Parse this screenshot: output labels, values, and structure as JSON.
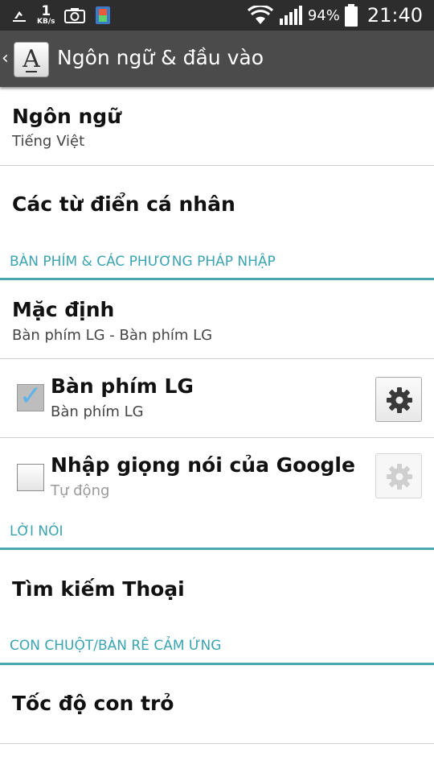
{
  "status_bar": {
    "data_rate_value": "1",
    "data_rate_unit": "KB/s",
    "battery_percent": "94%",
    "time": "21:40"
  },
  "action_bar": {
    "title": "Ngôn ngữ & đầu vào",
    "icon_glyph": "A"
  },
  "items": {
    "language": {
      "title": "Ngôn ngữ",
      "subtitle": "Tiếng Việt"
    },
    "personal_dictionary": {
      "title": "Các từ điển cá nhân"
    },
    "default_keyboard": {
      "title": "Mặc định",
      "subtitle": "Bàn phím LG - Bàn phím LG"
    },
    "lg_keyboard": {
      "title": "Bàn phím LG",
      "subtitle": "Bàn phím LG",
      "checked": true
    },
    "google_voice": {
      "title": "Nhập giọng nói của Google",
      "subtitle": "Tự động",
      "checked": false
    },
    "voice_search": {
      "title": "Tìm kiếm Thoại"
    },
    "pointer_speed": {
      "title": "Tốc độ con trỏ"
    }
  },
  "sections": {
    "keyboard_methods": "BÀN PHÍM & CÁC PHƯƠNG PHÁP NHẬP",
    "speech": "LỜI NÓI",
    "mouse_trackpad": "CON CHUỘT/BÀN RÊ CẢM ỨNG"
  },
  "colors": {
    "accent": "#3aa4b3",
    "action_bar": "#4b4b4b",
    "status_bar": "#2d2d2d"
  },
  "icons": [
    "usb-icon",
    "screenshot-icon",
    "battery-app-icon",
    "wifi-icon",
    "signal-icon",
    "battery-icon",
    "settings-gear-icon",
    "back-arrow-icon"
  ]
}
